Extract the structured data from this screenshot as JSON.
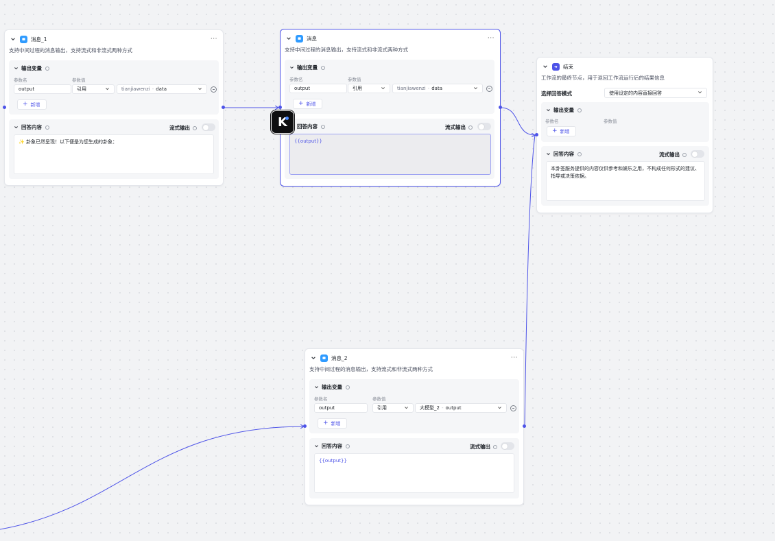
{
  "colors": {
    "accent": "#4d53e8",
    "message_icon": "#2f9bff",
    "end_icon": "#4d53e8"
  },
  "common": {
    "output_vars_label": "输出变量",
    "param_name_label": "参数名",
    "param_value_label": "参数值",
    "add_label": "新增",
    "answer_label": "回答内容",
    "stream_label": "流式输出",
    "more_label": "···",
    "ref_label": "引用"
  },
  "nodes": {
    "msg1": {
      "title": "消息_1",
      "desc": "支持中间过程的消息输出，支持流式和非流式两种方式",
      "var_name": "output",
      "ref_source": "tianjiawenzi",
      "ref_field": "data",
      "answer_text": "✨ 卦象已然呈现！以下便是为您生成的卦象："
    },
    "msg": {
      "title": "消息",
      "desc": "支持中间过程的消息输出，支持流式和非流式两种方式",
      "var_name": "output",
      "ref_source": "tianjiawenzi",
      "ref_field": "data",
      "answer_text": "{{output}}"
    },
    "end": {
      "title": "结束",
      "desc": "工作流的最终节点，用于返回工作流运行后的结果信息",
      "mode_label": "选择回答模式",
      "mode_value": "使用设定的内容直接回答",
      "answer_text": "本卦签服务提供的内容仅供参考和娱乐之用，不构成任何形式的建议、指导或决策依据。"
    },
    "msg2": {
      "title": "消息_2",
      "desc": "支持中间过程的消息输出，支持流式和非流式两种方式",
      "var_name": "output",
      "ref_source": "大模型_2",
      "ref_field": "output",
      "answer_text": "{{output}}"
    }
  },
  "logo": {
    "letter": "K"
  }
}
